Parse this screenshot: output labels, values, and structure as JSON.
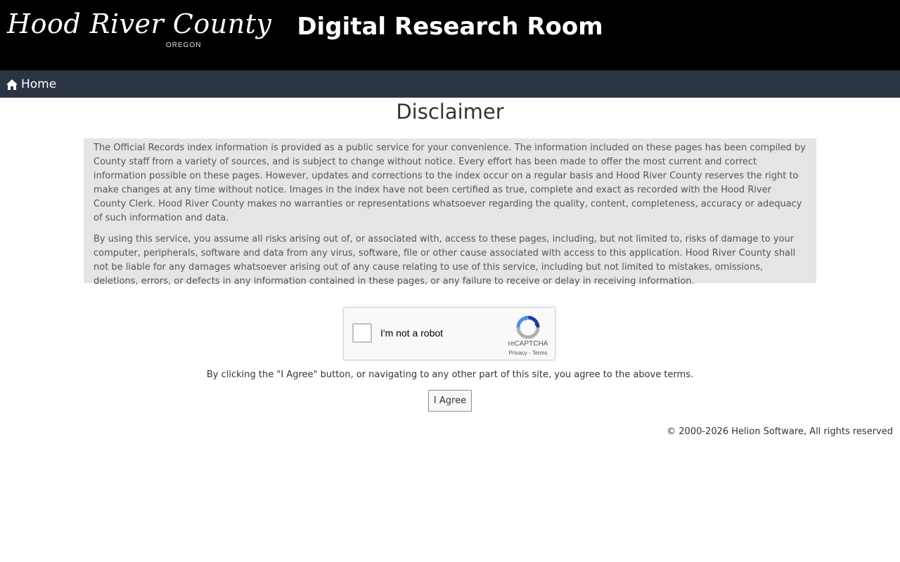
{
  "header": {
    "logo_text": "Hood River County",
    "logo_subtext": "OREGON",
    "title": "Digital Research Room"
  },
  "nav": {
    "home_label": "Home",
    "home_icon": "home-icon"
  },
  "main": {
    "heading": "Disclaimer",
    "disclaimer_paragraphs": [
      "The Official Records index information is provided as a public service for your convenience. The information included on these pages has been compiled by County staff from a variety of sources, and is subject to change without notice. Every effort has been made to offer the most current and correct information possible on these pages. However, updates and corrections to the index occur on a regular basis and Hood River County reserves the right to make changes at any time without notice. Images in the index have not been certified as true, complete and exact as recorded with the Hood River County Clerk. Hood River County makes no warranties or representations whatsoever regarding the quality, content, completeness, accuracy or adequacy of such information and data.",
      "By using this service, you assume all risks arising out of, or associated with, access to these pages, including, but not limited to, risks of damage to your computer, peripherals, software and data from any virus, software, file or other cause associated with access to this application. Hood River County shall not be liable for any damages whatsoever arising out of any cause relating to use of this service, including but not limited to mistakes, omissions, deletions, errors, or defects in any information contained in these pages, or any failure to receive or delay in receiving information."
    ],
    "agree_text": "By clicking the \"I Agree\" button, or navigating to any other part of this site, you agree to the above terms.",
    "agree_button": "I Agree"
  },
  "recaptcha": {
    "label": "I'm not a robot",
    "brand": "reCAPTCHA",
    "privacy": "Privacy",
    "separator": " - ",
    "terms": "Terms"
  },
  "footer": {
    "copyright": "© 2000-2026 Helion Software, All rights reserved"
  },
  "colors": {
    "header_bg": "#000000",
    "navbar_bg": "#2a3443",
    "disclaimer_bg": "#e5e5e5",
    "recaptcha_blue": "#1c3aa9",
    "recaptcha_lightblue": "#4a90e2",
    "recaptcha_gray": "#b0b0b0"
  }
}
